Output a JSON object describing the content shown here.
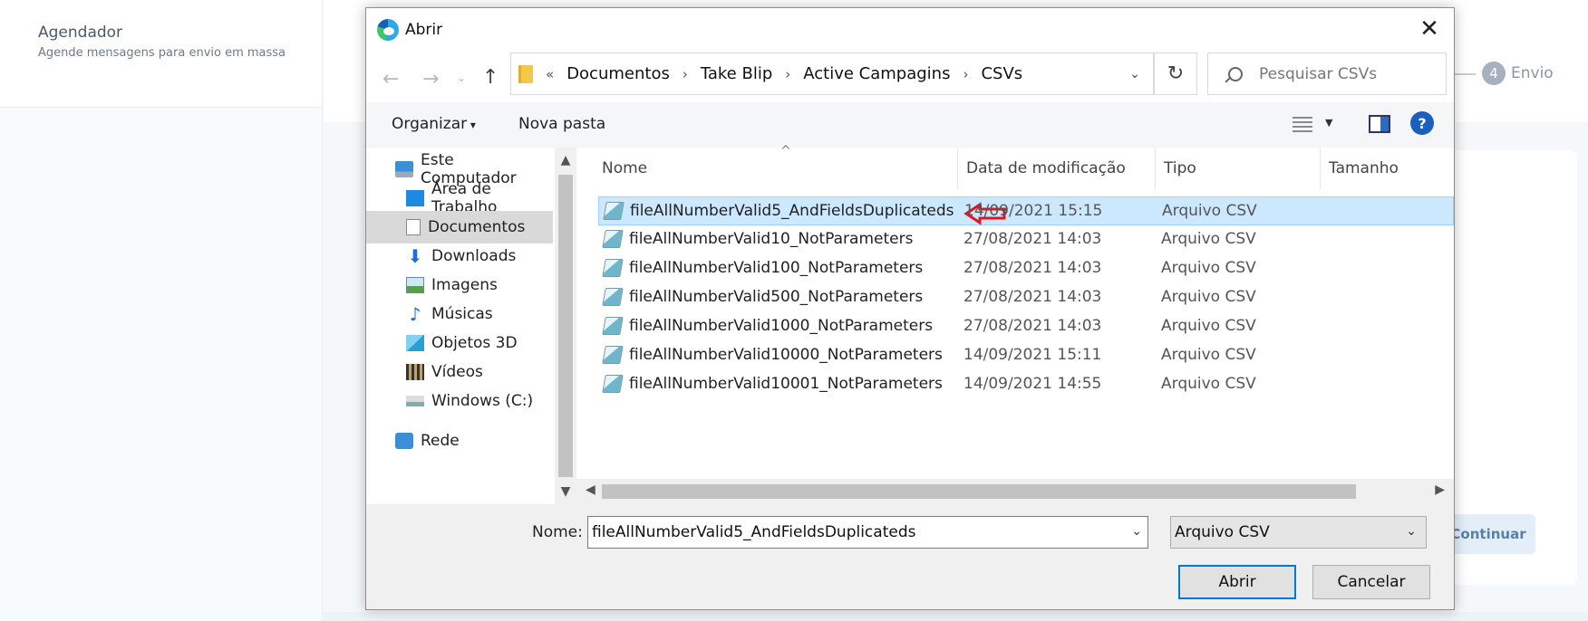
{
  "app": {
    "sidebar_title": "Agendador",
    "sidebar_subtitle": "Agende mensagens para envio em massa",
    "step_number": "4",
    "step_label": "Envio",
    "continue_button": "Continuar"
  },
  "dialog": {
    "title": "Abrir",
    "address": {
      "lead": "«",
      "crumbs": [
        "Documentos",
        "Take Blip",
        "Active Campagins",
        "CSVs"
      ]
    },
    "search_placeholder": "Pesquisar CSVs",
    "toolbar": {
      "organize": "Organizar",
      "new_folder": "Nova pasta",
      "help": "?"
    },
    "nav": [
      {
        "label": "Este Computador"
      },
      {
        "label": "Área de Trabalho"
      },
      {
        "label": "Documentos",
        "selected": true
      },
      {
        "label": "Downloads"
      },
      {
        "label": "Imagens"
      },
      {
        "label": "Músicas"
      },
      {
        "label": "Objetos 3D"
      },
      {
        "label": "Vídeos"
      },
      {
        "label": "Windows (C:)"
      },
      {
        "label": "Rede"
      }
    ],
    "columns": [
      "Nome",
      "Data de modificação",
      "Tipo",
      "Tamanho"
    ],
    "files": [
      {
        "name": "fileAllNumberValid5_AndFieldsDuplicateds",
        "date": "14/09/2021 15:15",
        "type": "Arquivo CSV",
        "selected": true
      },
      {
        "name": "fileAllNumberValid10_NotParameters",
        "date": "27/08/2021 14:03",
        "type": "Arquivo CSV"
      },
      {
        "name": "fileAllNumberValid100_NotParameters",
        "date": "27/08/2021 14:03",
        "type": "Arquivo CSV"
      },
      {
        "name": "fileAllNumberValid500_NotParameters",
        "date": "27/08/2021 14:03",
        "type": "Arquivo CSV"
      },
      {
        "name": "fileAllNumberValid1000_NotParameters",
        "date": "27/08/2021 14:03",
        "type": "Arquivo CSV"
      },
      {
        "name": "fileAllNumberValid10000_NotParameters",
        "date": "14/09/2021 15:11",
        "type": "Arquivo CSV"
      },
      {
        "name": "fileAllNumberValid10001_NotParameters",
        "date": "14/09/2021 14:55",
        "type": "Arquivo CSV"
      }
    ],
    "filename_label": "Nome:",
    "filename_value": "fileAllNumberValid5_AndFieldsDuplicateds",
    "filetype_value": "Arquivo CSV",
    "open_button": "Abrir",
    "cancel_button": "Cancelar"
  },
  "colors": {
    "selection": "#cce8ff",
    "accent": "#0078d7",
    "annotation_arrow": "#e0161b"
  }
}
